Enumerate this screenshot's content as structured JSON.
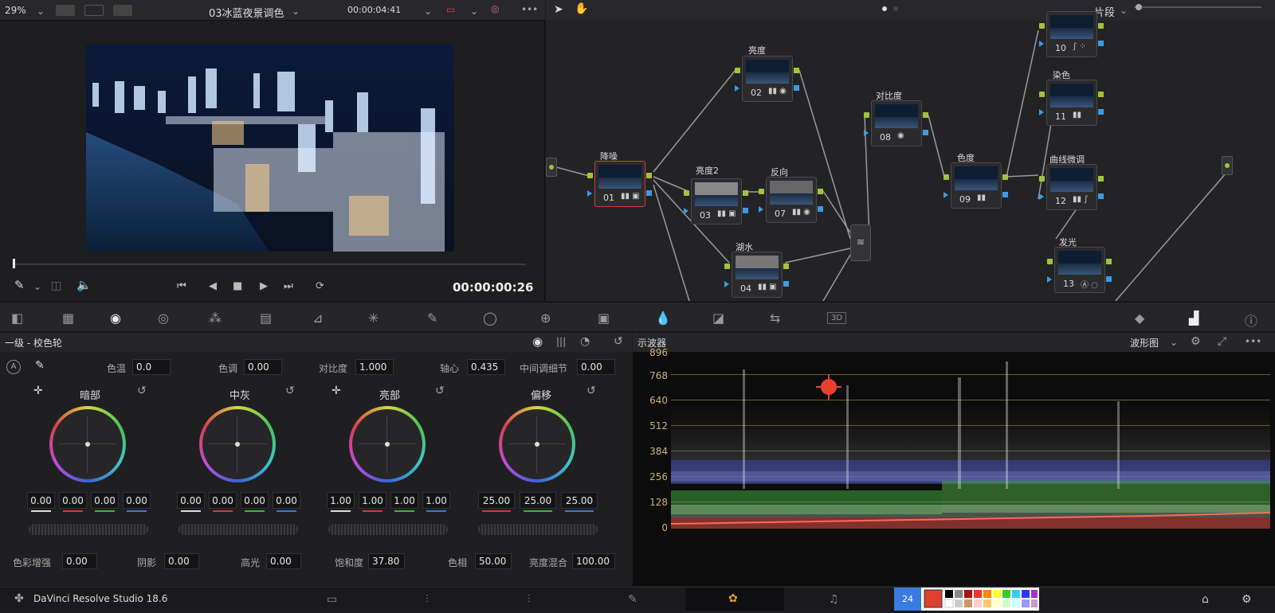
{
  "viewer": {
    "zoom": "29%",
    "clip_name": "03冰蓝夜景调色",
    "timecode": "00:00:04:41",
    "current_tc": "00:00:00:26"
  },
  "nodes_panel": {
    "mode": "片段",
    "nodes": [
      {
        "label": "降噪",
        "num": "01"
      },
      {
        "label": "亮度",
        "num": "02"
      },
      {
        "label": "亮度2",
        "num": "03"
      },
      {
        "label": "湖水",
        "num": "04"
      },
      {
        "label": "反向",
        "num": "07"
      },
      {
        "label": "对比度",
        "num": "08"
      },
      {
        "label": "色度",
        "num": "09"
      },
      {
        "label": "",
        "num": "10"
      },
      {
        "label": "染色",
        "num": "11"
      },
      {
        "label": "曲线微调",
        "num": "12"
      },
      {
        "label": "发光",
        "num": "13"
      }
    ]
  },
  "wheels_panel": {
    "title": "一级 - 校色轮",
    "params_top": {
      "temp_label": "色温",
      "temp": "0.0",
      "tint_label": "色调",
      "tint": "0.00",
      "contrast_label": "对比度",
      "contrast": "1.000",
      "pivot_label": "轴心",
      "pivot": "0.435",
      "md_label": "中间调细节",
      "md": "0.00"
    },
    "wheels": [
      {
        "name": "暗部",
        "values": [
          "0.00",
          "0.00",
          "0.00",
          "0.00"
        ]
      },
      {
        "name": "中灰",
        "values": [
          "0.00",
          "0.00",
          "0.00",
          "0.00"
        ]
      },
      {
        "name": "亮部",
        "values": [
          "1.00",
          "1.00",
          "1.00",
          "1.00"
        ]
      },
      {
        "name": "偏移",
        "values": [
          "25.00",
          "25.00",
          "25.00"
        ]
      }
    ],
    "params_bottom": {
      "boost_label": "色彩增强",
      "boost": "0.00",
      "shadow_label": "阴影",
      "shadow": "0.00",
      "hl_label": "高光",
      "hl": "0.00",
      "sat_label": "饱和度",
      "sat": "37.80",
      "hue_label": "色相",
      "hue": "50.00",
      "lm_label": "亮度混合",
      "lm": "100.00"
    }
  },
  "scope": {
    "title": "示波器",
    "mode": "波形图",
    "ticks": [
      "896",
      "768",
      "640",
      "512",
      "384",
      "256",
      "128",
      "0"
    ]
  },
  "statusbar": {
    "app": "DaVinci Resolve Studio 18.6",
    "swatch_num": "24"
  },
  "colors": {
    "accent": "#c8442a",
    "green_port": "#a2c43a",
    "blue_port": "#3a9de0"
  }
}
